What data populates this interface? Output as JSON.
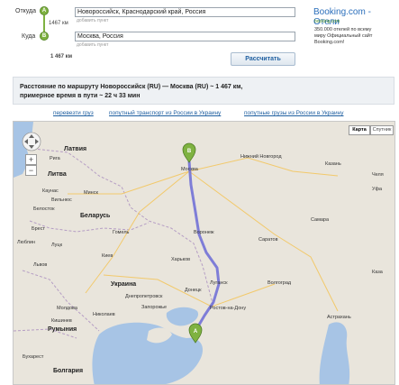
{
  "route": {
    "from_label": "Откуда",
    "to_label": "Куда",
    "from_marker": "A",
    "to_marker": "B",
    "from_value": "Новороссийск, Краснодарский край, Россия",
    "to_value": "Москва, Россия",
    "add_point_1": "добавить пункт",
    "add_point_2": "добавить пункт",
    "segment_km": "1467 км",
    "total_km": "1 467 км",
    "calc_button": "Рассчитать"
  },
  "ad": {
    "title": "Booking.com - Отели",
    "url": "booking.com",
    "line1": "350.000 отелей по всему",
    "line2": "миру Официальный сайт",
    "line3": "Booking.com!"
  },
  "summary": {
    "line1": "Расстояние по маршруту Новороссийск (RU) — Москва (RU) ~ 1 467 км,",
    "line2": "примерное время в пути ~ 22 ч 33 мин"
  },
  "links": {
    "l1": "перевезти груз",
    "l2": "попутный транспорт из России в Украину",
    "l3": "попутные грузы из России в Украину"
  },
  "map": {
    "type_map": "Карта",
    "type_sat": "Спутник",
    "zoom_in": "+",
    "zoom_out": "−",
    "cities": {
      "latvia": "Латвия",
      "lithuania": "Литва",
      "riga": "Рига",
      "kaunas": "Каунас",
      "vilnius": "Вильнюс",
      "minsk": "Минск",
      "belarus": "Беларусь",
      "bialystok": "Белосток",
      "gomel": "Гомель",
      "brest": "Брест",
      "lublin": "Люблин",
      "lutsk": "Луцк",
      "kyiv": "Киев",
      "lviv": "Львов",
      "ukraine": "Украина",
      "kharkiv": "Харьков",
      "dnipro": "Днепропетровск",
      "zaporizhzhia": "Запорожье",
      "donetsk": "Донецк",
      "mykolaiv": "Николаев",
      "moldova": "Молдова",
      "kishinev": "Кишинев",
      "romania": "Румыния",
      "bucharest": "Бухарест",
      "bulgaria": "Болгария",
      "moscow": "Москва",
      "novgorod": "Нижний Новгород",
      "kazan": "Казань",
      "samara": "Самара",
      "saratov": "Саратов",
      "voronezh": "Воронеж",
      "volgograd": "Волгоград",
      "lugansk": "Луганск",
      "rostov": "Ростов-на-Дону",
      "astrakhan": "Астрахань",
      "ufa": "Уфа",
      "kazakh": "Каза",
      "chelyabinsk": "Челя"
    },
    "markers": {
      "start": "A",
      "end": "B"
    }
  }
}
